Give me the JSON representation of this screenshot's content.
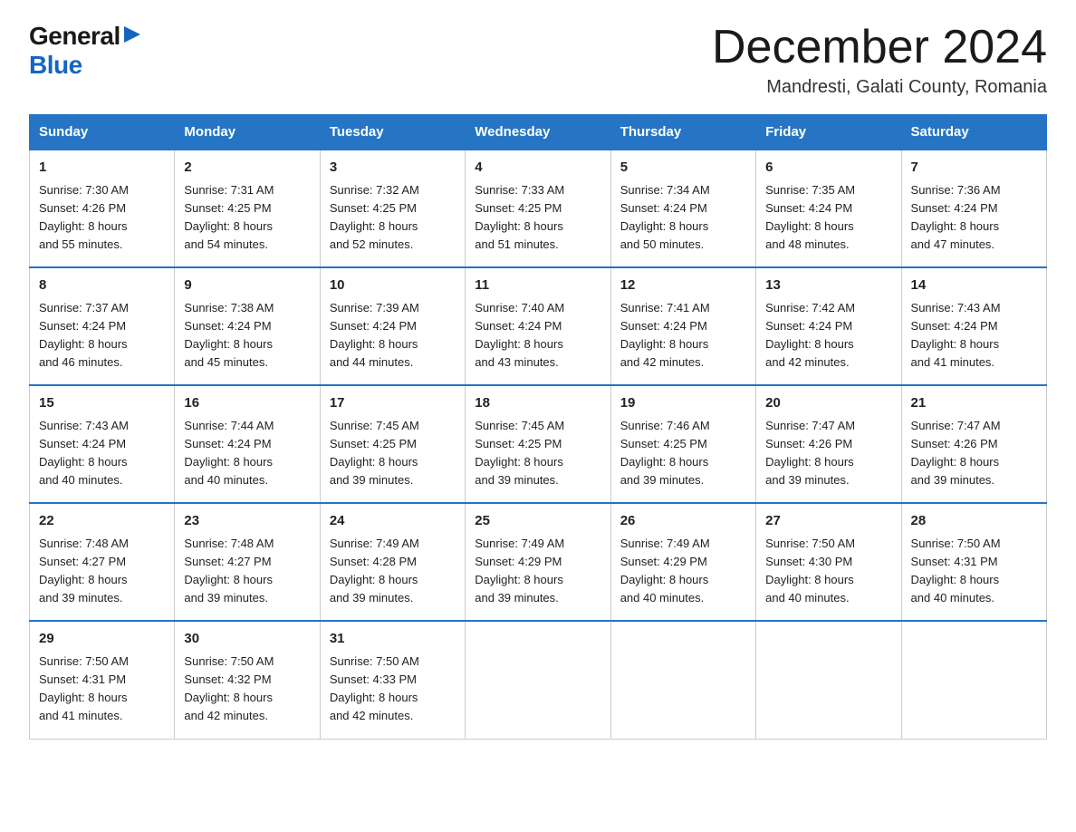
{
  "logo": {
    "general": "General",
    "blue": "Blue"
  },
  "title": {
    "month": "December 2024",
    "location": "Mandresti, Galati County, Romania"
  },
  "headers": [
    "Sunday",
    "Monday",
    "Tuesday",
    "Wednesday",
    "Thursday",
    "Friday",
    "Saturday"
  ],
  "weeks": [
    [
      {
        "day": "1",
        "sunrise": "7:30 AM",
        "sunset": "4:26 PM",
        "daylight": "8 hours and 55 minutes."
      },
      {
        "day": "2",
        "sunrise": "7:31 AM",
        "sunset": "4:25 PM",
        "daylight": "8 hours and 54 minutes."
      },
      {
        "day": "3",
        "sunrise": "7:32 AM",
        "sunset": "4:25 PM",
        "daylight": "8 hours and 52 minutes."
      },
      {
        "day": "4",
        "sunrise": "7:33 AM",
        "sunset": "4:25 PM",
        "daylight": "8 hours and 51 minutes."
      },
      {
        "day": "5",
        "sunrise": "7:34 AM",
        "sunset": "4:24 PM",
        "daylight": "8 hours and 50 minutes."
      },
      {
        "day": "6",
        "sunrise": "7:35 AM",
        "sunset": "4:24 PM",
        "daylight": "8 hours and 48 minutes."
      },
      {
        "day": "7",
        "sunrise": "7:36 AM",
        "sunset": "4:24 PM",
        "daylight": "8 hours and 47 minutes."
      }
    ],
    [
      {
        "day": "8",
        "sunrise": "7:37 AM",
        "sunset": "4:24 PM",
        "daylight": "8 hours and 46 minutes."
      },
      {
        "day": "9",
        "sunrise": "7:38 AM",
        "sunset": "4:24 PM",
        "daylight": "8 hours and 45 minutes."
      },
      {
        "day": "10",
        "sunrise": "7:39 AM",
        "sunset": "4:24 PM",
        "daylight": "8 hours and 44 minutes."
      },
      {
        "day": "11",
        "sunrise": "7:40 AM",
        "sunset": "4:24 PM",
        "daylight": "8 hours and 43 minutes."
      },
      {
        "day": "12",
        "sunrise": "7:41 AM",
        "sunset": "4:24 PM",
        "daylight": "8 hours and 42 minutes."
      },
      {
        "day": "13",
        "sunrise": "7:42 AM",
        "sunset": "4:24 PM",
        "daylight": "8 hours and 42 minutes."
      },
      {
        "day": "14",
        "sunrise": "7:43 AM",
        "sunset": "4:24 PM",
        "daylight": "8 hours and 41 minutes."
      }
    ],
    [
      {
        "day": "15",
        "sunrise": "7:43 AM",
        "sunset": "4:24 PM",
        "daylight": "8 hours and 40 minutes."
      },
      {
        "day": "16",
        "sunrise": "7:44 AM",
        "sunset": "4:24 PM",
        "daylight": "8 hours and 40 minutes."
      },
      {
        "day": "17",
        "sunrise": "7:45 AM",
        "sunset": "4:25 PM",
        "daylight": "8 hours and 39 minutes."
      },
      {
        "day": "18",
        "sunrise": "7:45 AM",
        "sunset": "4:25 PM",
        "daylight": "8 hours and 39 minutes."
      },
      {
        "day": "19",
        "sunrise": "7:46 AM",
        "sunset": "4:25 PM",
        "daylight": "8 hours and 39 minutes."
      },
      {
        "day": "20",
        "sunrise": "7:47 AM",
        "sunset": "4:26 PM",
        "daylight": "8 hours and 39 minutes."
      },
      {
        "day": "21",
        "sunrise": "7:47 AM",
        "sunset": "4:26 PM",
        "daylight": "8 hours and 39 minutes."
      }
    ],
    [
      {
        "day": "22",
        "sunrise": "7:48 AM",
        "sunset": "4:27 PM",
        "daylight": "8 hours and 39 minutes."
      },
      {
        "day": "23",
        "sunrise": "7:48 AM",
        "sunset": "4:27 PM",
        "daylight": "8 hours and 39 minutes."
      },
      {
        "day": "24",
        "sunrise": "7:49 AM",
        "sunset": "4:28 PM",
        "daylight": "8 hours and 39 minutes."
      },
      {
        "day": "25",
        "sunrise": "7:49 AM",
        "sunset": "4:29 PM",
        "daylight": "8 hours and 39 minutes."
      },
      {
        "day": "26",
        "sunrise": "7:49 AM",
        "sunset": "4:29 PM",
        "daylight": "8 hours and 40 minutes."
      },
      {
        "day": "27",
        "sunrise": "7:50 AM",
        "sunset": "4:30 PM",
        "daylight": "8 hours and 40 minutes."
      },
      {
        "day": "28",
        "sunrise": "7:50 AM",
        "sunset": "4:31 PM",
        "daylight": "8 hours and 40 minutes."
      }
    ],
    [
      {
        "day": "29",
        "sunrise": "7:50 AM",
        "sunset": "4:31 PM",
        "daylight": "8 hours and 41 minutes."
      },
      {
        "day": "30",
        "sunrise": "7:50 AM",
        "sunset": "4:32 PM",
        "daylight": "8 hours and 42 minutes."
      },
      {
        "day": "31",
        "sunrise": "7:50 AM",
        "sunset": "4:33 PM",
        "daylight": "8 hours and 42 minutes."
      },
      null,
      null,
      null,
      null
    ]
  ],
  "labels": {
    "sunrise": "Sunrise:",
    "sunset": "Sunset:",
    "daylight": "Daylight:"
  }
}
